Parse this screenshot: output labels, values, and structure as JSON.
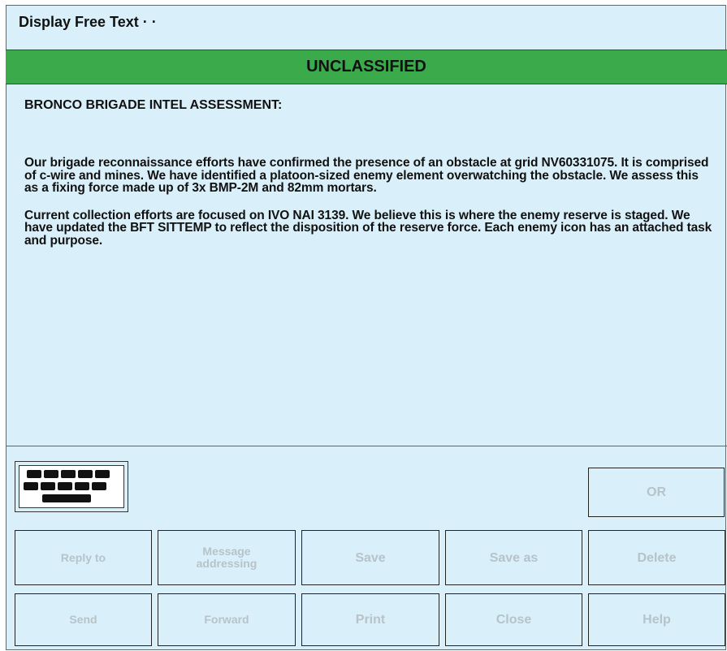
{
  "window": {
    "title": "Display Free Text · ·"
  },
  "banner": {
    "classification": "UNCLASSIFIED",
    "color": "#3aaa4b"
  },
  "message": {
    "heading": "BRONCO BRIGADE INTEL ASSESSMENT:",
    "paragraphs": [
      "Our brigade reconnaissance efforts have confirmed the presence of an obstacle at grid NV60331075.  It is comprised of c-wire and mines. We have identified a platoon-sized enemy element overwatching the obstacle. We assess this as a fixing force made up of 3x BMP-2M and 82mm mortars.",
      "Current collection efforts are focused on IVO NAI 3139.  We believe this is where the enemy reserve is staged. We have updated the BFT SITTEMP to reflect the disposition of the reserve force.  Each enemy icon has an attached task and purpose."
    ]
  },
  "keyboard": {
    "icon": "keyboard-icon"
  },
  "buttons": {
    "or": "OR",
    "reply_to": "Reply to",
    "message_addressing": "Message addressing",
    "save": "Save",
    "save_as": "Save as",
    "delete": "Delete",
    "send": "Send",
    "forward": "Forward",
    "print": "Print",
    "close": "Close",
    "help": "Help"
  }
}
